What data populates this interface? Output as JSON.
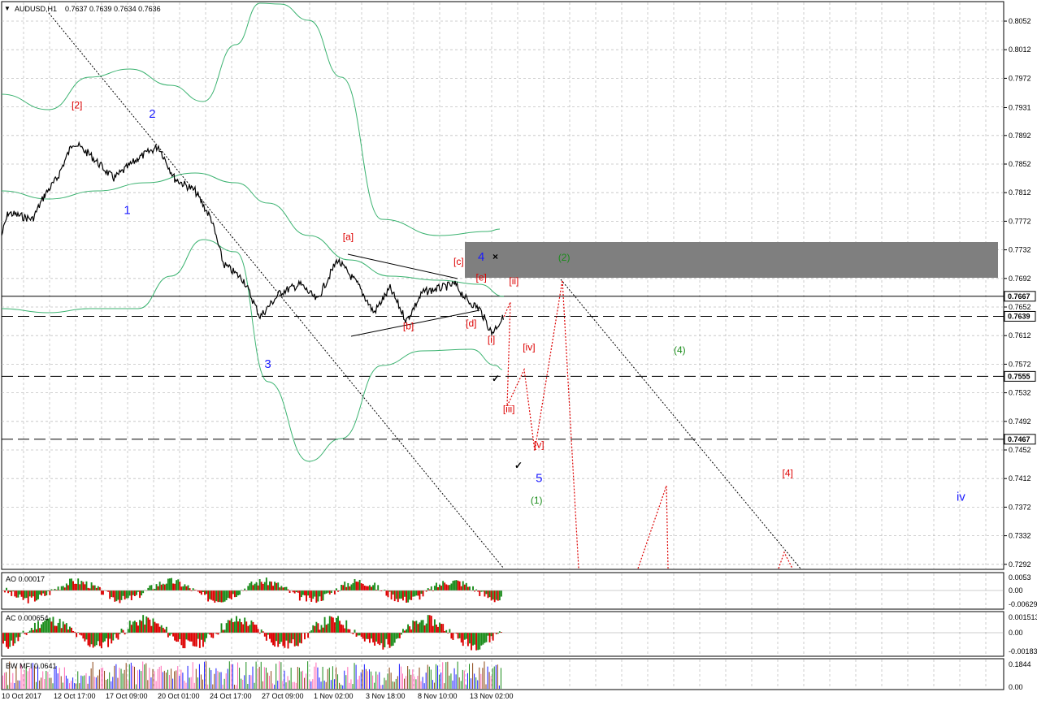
{
  "header": {
    "arrow": "▼",
    "symbol": "AUDUSD,H1",
    "ohlc": "0.7637 0.7639 0.7634 0.7636"
  },
  "price_axis": {
    "ticks": [
      "0.8052",
      "0.8012",
      "0.7972",
      "0.7931",
      "0.7892",
      "0.7852",
      "0.7812",
      "0.7772",
      "0.7732",
      "0.7692",
      "0.7652",
      "0.7612",
      "0.7572",
      "0.7532",
      "0.7492",
      "0.7452",
      "0.7412",
      "0.7372",
      "0.7332",
      "0.7292"
    ],
    "markers": [
      {
        "label": "0.7667",
        "value": 0.7667,
        "style": "solid",
        "box": "white"
      },
      {
        "label": "0.7639",
        "value": 0.7639,
        "style": "dashed",
        "box": "white"
      },
      {
        "label": "0.7555",
        "value": 0.7555,
        "style": "dashed",
        "box": "white"
      },
      {
        "label": "0.7467",
        "value": 0.7467,
        "style": "dashed",
        "box": "white"
      }
    ]
  },
  "time_axis": {
    "labels": [
      "10 Oct 2017",
      "12 Oct 17:00",
      "17 Oct 09:00",
      "20 Oct 01:00",
      "24 Oct 17:00",
      "27 Oct 09:00",
      "1 Nov 02:00",
      "3 Nov 18:00",
      "8 Nov 10:00",
      "13 Nov 02:00"
    ]
  },
  "indicators": {
    "ao": {
      "title": "AO 0.00017",
      "ticks": [
        "0.0053",
        "0.00",
        "-0.00629"
      ]
    },
    "ac": {
      "title": "AC 0.000654",
      "ticks": [
        "0.001513",
        "0.00",
        "-0.00183"
      ]
    },
    "mfi": {
      "title": "BW MFI 0.0641",
      "ticks": [
        "0.1844",
        "0.00"
      ]
    }
  },
  "wave_labels": [
    {
      "text": "[2]",
      "color": "#dd0000",
      "price": 0.793,
      "t": 0.15
    },
    {
      "text": "2",
      "color": "#1a1aff",
      "price": 0.7917,
      "t": 0.3
    },
    {
      "text": "1",
      "color": "#1a1aff",
      "price": 0.7782,
      "t": 0.25
    },
    {
      "text": "3",
      "color": "#1a1aff",
      "price": 0.7567,
      "t": 0.53
    },
    {
      "text": "[a]",
      "color": "#dd0000",
      "price": 0.7746,
      "t": 0.69
    },
    {
      "text": "[b]",
      "color": "#dd0000",
      "price": 0.7621,
      "t": 0.81
    },
    {
      "text": "[c]",
      "color": "#dd0000",
      "price": 0.7711,
      "t": 0.91
    },
    {
      "text": "4",
      "color": "#1a1aff",
      "price": 0.7717,
      "t": 0.955
    },
    {
      "text": "[e]",
      "color": "#dd0000",
      "price": 0.7689,
      "t": 0.955
    },
    {
      "text": "[d]",
      "color": "#dd0000",
      "price": 0.7625,
      "t": 0.935
    },
    {
      "text": "[i]",
      "color": "#dd0000",
      "price": 0.7602,
      "t": 0.975
    },
    {
      "text": "[ii]",
      "color": "#dd0000",
      "price": 0.7684,
      "t": 1.02
    },
    {
      "text": "[iv]",
      "color": "#dd0000",
      "price": 0.7591,
      "t": 1.05
    },
    {
      "text": "[iii]",
      "color": "#dd0000",
      "price": 0.7505,
      "t": 1.01
    },
    {
      "text": "[v]",
      "color": "#dd0000",
      "price": 0.7455,
      "t": 1.07
    },
    {
      "text": "5",
      "color": "#1a1aff",
      "price": 0.7407,
      "t": 1.07
    },
    {
      "text": "(1)",
      "color": "#1a8c1a",
      "price": 0.7377,
      "t": 1.065
    },
    {
      "text": "(2)",
      "color": "#1a8c1a",
      "price": 0.7717,
      "t": 1.12
    },
    {
      "text": "(4)",
      "color": "#1a8c1a",
      "price": 0.7587,
      "t": 1.35
    },
    {
      "text": "[4]",
      "color": "#dd0000",
      "price": 0.7415,
      "t": 1.565
    },
    {
      "text": "iv",
      "color": "#1a1aff",
      "price": 0.7381,
      "t": 1.91
    }
  ],
  "colors": {
    "price": "#000000",
    "envelope": "#3cb371",
    "zone": "#7f7f7f",
    "projection": "#dd0000",
    "grid": "#c0c0c0",
    "up_bar": "#1a8c1a",
    "down_bar": "#dd0000"
  }
}
